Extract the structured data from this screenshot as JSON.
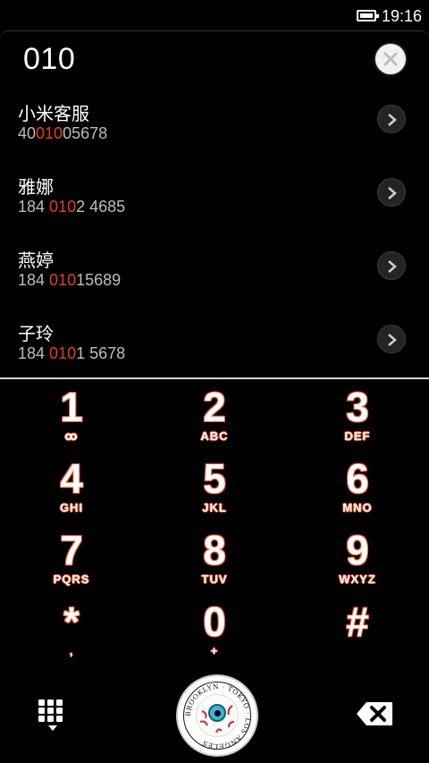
{
  "status_bar": {
    "time": "19:16"
  },
  "search": {
    "query": "010"
  },
  "contacts": [
    {
      "name": "小米客服",
      "number_pre": "40",
      "number_match": "010",
      "number_post": "05678"
    },
    {
      "name": "雅娜",
      "number_pre": "184 ",
      "number_match": "010",
      "number_post": "2 4685"
    },
    {
      "name": "燕婷",
      "number_pre": "184 ",
      "number_match": "010",
      "number_post": "15689"
    },
    {
      "name": "子玲",
      "number_pre": "184 ",
      "number_match": "010",
      "number_post": "1 5678"
    }
  ],
  "keypad": [
    {
      "digit": "1",
      "letters": "ꝏ"
    },
    {
      "digit": "2",
      "letters": "ABC"
    },
    {
      "digit": "3",
      "letters": "DEF"
    },
    {
      "digit": "4",
      "letters": "GHI"
    },
    {
      "digit": "5",
      "letters": "JKL"
    },
    {
      "digit": "6",
      "letters": "MNO"
    },
    {
      "digit": "7",
      "letters": "PQRS"
    },
    {
      "digit": "8",
      "letters": "TUV"
    },
    {
      "digit": "9",
      "letters": "WXYZ"
    },
    {
      "digit": "*",
      "letters": ","
    },
    {
      "digit": "0",
      "letters": "+"
    },
    {
      "digit": "#",
      "letters": ""
    }
  ],
  "call_badge": {
    "ring_text": "BROOKLYN · TOKYO · LOS ANGELES"
  },
  "colors": {
    "highlight": "#e4401d",
    "key_outline": "#e8502a",
    "background": "#000000"
  },
  "icons": {
    "battery": "battery-icon",
    "clear": "close-icon",
    "contact_arrow": "chevron-right-icon",
    "dialpad_toggle": "dialpad-grid-icon",
    "call": "eyeball-call-icon",
    "backspace": "backspace-icon"
  }
}
